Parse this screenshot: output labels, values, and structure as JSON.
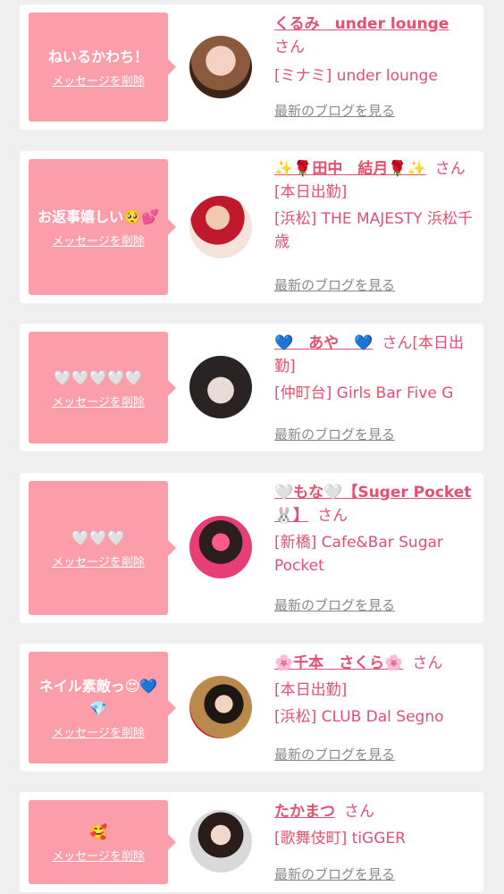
{
  "cards": [
    {
      "message": "ねいるかわち！",
      "delete_label": "メッセージを削除",
      "name": "くるみ　under lounge",
      "suffix": "さん",
      "shop": "[ミナミ] under lounge",
      "blog_label": "最新のブログを見る"
    },
    {
      "message": "お返事嬉しい🥺💕",
      "delete_label": "メッセージを削除",
      "name": "✨🌹田中　結月🌹✨",
      "suffix": "さん[本日出勤]",
      "shop": "[浜松] THE MAJESTY 浜松千歳",
      "blog_label": "最新のブログを見る"
    },
    {
      "message": "🤍🤍🤍🤍🤍",
      "delete_label": "メッセージを削除",
      "name": "💙　あや　💙",
      "suffix": "さん[本日出勤]",
      "shop": "[仲町台] Girls Bar Five G",
      "blog_label": "最新のブログを見る"
    },
    {
      "message": "🤍🤍🤍",
      "delete_label": "メッセージを削除",
      "name": "🤍もな🤍【Suger Pocket🐰】",
      "suffix": "さん",
      "shop": "[新橋] Cafe&Bar Sugar Pocket",
      "blog_label": "最新のブログを見る"
    },
    {
      "message": "ネイル素敵っ😍💙💎",
      "delete_label": "メッセージを削除",
      "name": "🌸千本　さくら🌸",
      "suffix": "さん",
      "shop_status": "[本日出勤]",
      "shop": "[浜松] CLUB Dal Segno",
      "blog_label": "最新のブログを見る"
    },
    {
      "message": "🥰",
      "delete_label": "メッセージを削除",
      "name": "たかまつ",
      "suffix": "さん",
      "shop": "[歌舞伎町] tiGGER",
      "blog_label": "最新のブログを見る"
    }
  ]
}
